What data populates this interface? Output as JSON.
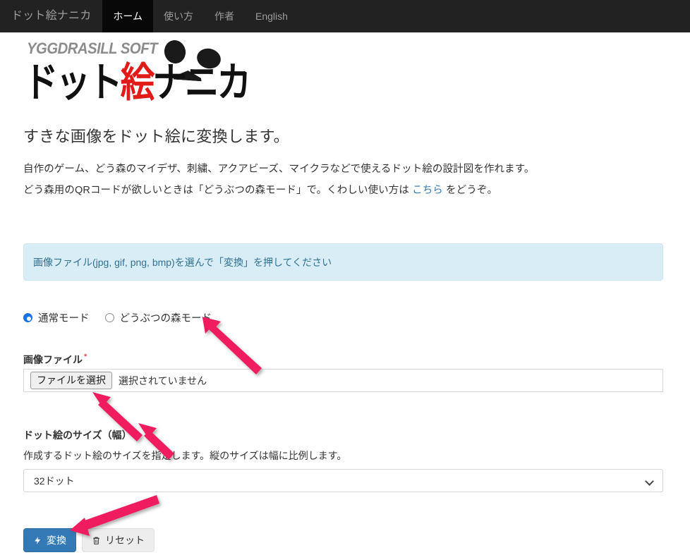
{
  "navbar": {
    "brand": "ドット絵ナニカ",
    "items": [
      {
        "label": "ホーム",
        "active": true
      },
      {
        "label": "使い方",
        "active": false
      },
      {
        "label": "作者",
        "active": false
      },
      {
        "label": "English",
        "active": false
      }
    ]
  },
  "logo": {
    "top_text": "YGGDRASILL SOFT",
    "main_part1": "ドット",
    "main_red": "絵",
    "main_part2": "ナニカ"
  },
  "content": {
    "lead": "すきな画像をドット絵に変換します。",
    "paragraph1": "自作のゲーム、どう森のマイデザ、刺繍、アクアビーズ、マイクラなどで使えるドット絵の設計図を作れます。",
    "paragraph2_before": "どう森用のQRコードが欲しいときは「どうぶつの森モード」で。くわしい使い方は ",
    "paragraph2_link": "こちら",
    "paragraph2_after": " をどうぞ。"
  },
  "alert": {
    "text": "画像ファイル(jpg, gif, png, bmp)を選んで「変換」を押してください",
    "bg_color": "#d9edf7",
    "text_color": "#31708f"
  },
  "mode": {
    "options": [
      {
        "label": "通常モード",
        "checked": true
      },
      {
        "label": "どうぶつの森モード",
        "checked": false
      }
    ],
    "accent_color": "#1a73e8"
  },
  "file_field": {
    "label": "画像ファイル",
    "required_mark": "*",
    "button_label": "ファイルを選択",
    "status_text": "選択されていません"
  },
  "size_field": {
    "label": "ドット絵のサイズ（幅）",
    "required_mark": "*",
    "help": "作成するドット絵のサイズを指定します。縦のサイズは幅に比例します。",
    "selected_value": "32ドット"
  },
  "buttons": {
    "convert_label": "変換",
    "convert_icon": "lightning-bolt-icon",
    "convert_color": "#337ab7",
    "reset_label": "リセット",
    "reset_icon": "trash-icon",
    "reset_color": "#ededed"
  },
  "annotations": {
    "arrow_color": "#ef1d5e",
    "count": 4
  }
}
